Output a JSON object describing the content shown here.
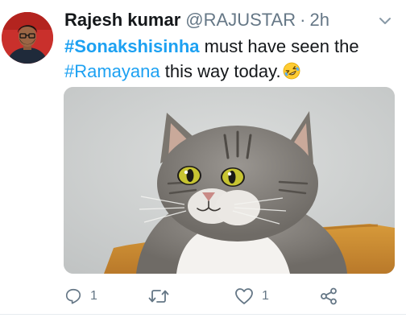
{
  "tweet": {
    "author_name": "Rajesh kumar",
    "handle": "@RAJUSTAR",
    "separator": "·",
    "time": "2h",
    "text": {
      "hashtag1": "#Sonakshisinha",
      "part1": " must have seen the",
      "hashtag2": "#Ramayana",
      "part2": " this way today."
    },
    "emoji": "rolling-on-floor-laughing-emoji",
    "media": {
      "subject": "cat-photo"
    }
  },
  "actions": {
    "reply_count": "1",
    "retweet_count": "",
    "like_count": "1",
    "share_count": ""
  },
  "colors": {
    "link": "#1da1f2",
    "secondary_text": "#657786",
    "primary_text": "#14171a",
    "divider": "#e6ecf0"
  },
  "icons": {
    "menu": "chevron-down-icon",
    "reply": "reply-icon",
    "retweet": "retweet-icon",
    "like": "heart-icon",
    "share": "share-icon"
  }
}
